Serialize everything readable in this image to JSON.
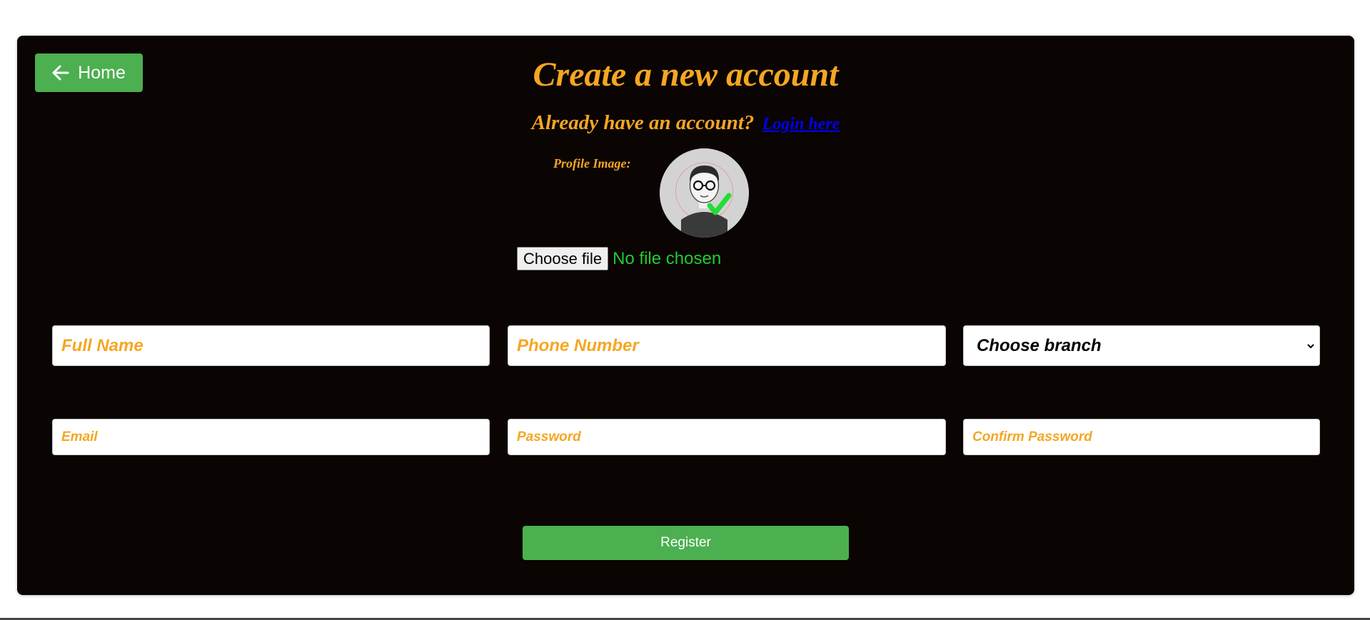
{
  "nav": {
    "home_label": "Home"
  },
  "header": {
    "title": "Create a new account",
    "subtitle": "Already have an account?",
    "login_link": "Login here"
  },
  "profile": {
    "label": "Profile Image:",
    "avatar_icon": "avatar-placeholder-icon",
    "choose_file_label": "Choose file",
    "file_status": "No file chosen"
  },
  "form": {
    "full_name_placeholder": "Full Name",
    "phone_placeholder": "Phone Number",
    "branch_selected": "Choose branch",
    "email_placeholder": "Email",
    "password_placeholder": "Password",
    "confirm_password_placeholder": "Confirm Password",
    "register_label": "Register"
  },
  "colors": {
    "accent": "#f5a623",
    "button_green": "#4caf50",
    "card_bg": "#0a0402",
    "file_status": "#22cc33",
    "link": "#0000ee"
  }
}
